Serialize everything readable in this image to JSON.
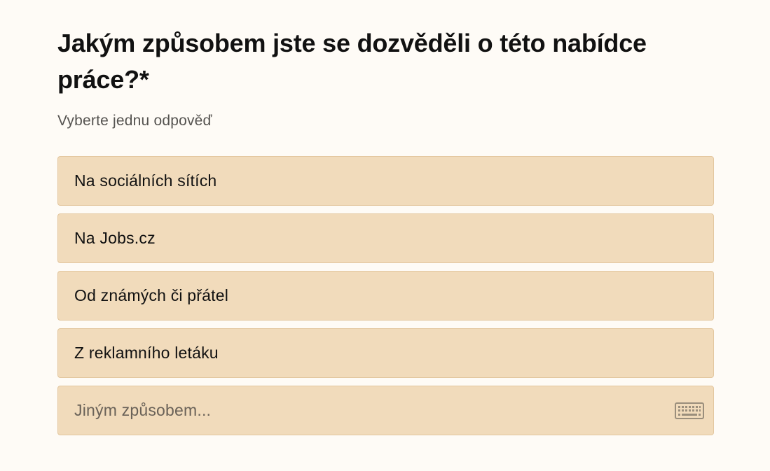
{
  "question": {
    "title": "Jakým způsobem jste se dozvěděli o této nabídce práce?*",
    "hint": "Vyberte jednu odpověď"
  },
  "options": [
    {
      "label": "Na sociálních sítích"
    },
    {
      "label": "Na Jobs.cz"
    },
    {
      "label": "Od známých či přátel"
    },
    {
      "label": "Z reklamního letáku"
    }
  ],
  "other": {
    "placeholder": "Jiným způsobem...",
    "value": "",
    "icon": "keyboard-icon"
  },
  "colors": {
    "background": "#fefbf6",
    "option_fill": "#f1dbbb",
    "option_border": "#e3c79f",
    "text": "#111111",
    "hint": "#555350"
  }
}
